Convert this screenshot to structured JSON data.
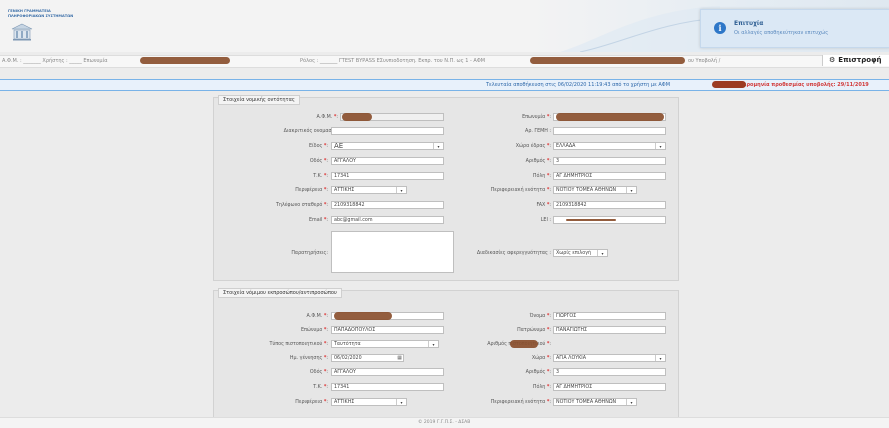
{
  "header": {
    "logo_line1": "ΓΕΝΙΚΗ ΓΡΑΜΜΑΤΕΙΑ",
    "logo_line2": "ΠΛΗΡΟΦΟΡΙΑΚΩΝ ΣΥΣΤΗΜΑΤΩΝ"
  },
  "notification": {
    "title": "Επιτυχία",
    "message": "Οι αλλαγές αποθηκεύτηκαν επιτυχώς"
  },
  "infobar": {
    "afm": "Α.Φ.Μ. : _______ Χρήστης : _____ Επωνυμία",
    "user": "",
    "role": "Ρόλος : _______  ΓΤΕST ΒΥΡΑSS ΕΣυνπιοδοτηση. Εκπρ. του Ν.Π. ως 1 - ΑΦΜ",
    "profile": "ου Υποβολή /",
    "back_label": "Επιστροφή"
  },
  "savebar": {
    "saved_text": "Τελευταία αποθήκευση στις 06/02/2020 11:19:43 από το χρήστη με ΑΦΜ",
    "deadline_text": "μερομηνία προθεσμίας υποβολής: 29/11/2019"
  },
  "section1": {
    "legend": "Στοιχεία νομικής οντότητας",
    "afm_label": "Α.Φ.Μ.",
    "company_name_label": "Επωνυμία",
    "distinctive_title_label": "Διακριτικός ονομασία:",
    "gemi_label": "Αρ. ΓΕΜΗ :",
    "type_label": "Είδος",
    "type_value": "ΑΕ",
    "country_label": "Χώρα έδρας",
    "country_value": "ΕΛΛΑΔΑ",
    "street_label": "Οδός",
    "street_value": "ΑΓΓΑΛΟΥ",
    "number_label": "Αριθμός",
    "number_value": "3",
    "zip_label": "Τ.Κ.",
    "zip_value": "17341",
    "city_label": "Πόλη",
    "city_value": "ΑΓ ΔΗΜΗΤΡΙΟΣ",
    "region_label": "Περιφέρεια",
    "region_value": "ΑΤΤΙΚΗΣ",
    "regional_unit_label": "Περιφερειακή ενότητα",
    "regional_unit_value": "ΝΟΤΙΟΥ ΤΟΜΕΑ ΑΘΗΝΩΝ",
    "phone_label": "Τηλέφωνο σταθερό",
    "phone_value": "2109318842",
    "fax_label": "FAX",
    "fax_value": "2109318842",
    "email_label": "Email",
    "email_value": "abc@gmail.com",
    "lei_label": "LEI :",
    "notes_label": "Παρατηρήσεις:",
    "auth_label": "Διαδικασίες αφερεγγυότητας :",
    "auth_value": "Χωρίς επιλογή"
  },
  "section2": {
    "legend": "Στοιχεία νόμιμου εκπροσώπου/αντιπροσώπου",
    "afm_label": "Α.Φ.Μ.",
    "first_name_label": "Όνομα",
    "first_name_value": "ΓΙΩΡΓΟΣ",
    "surname_label": "Επώνυμο",
    "surname_value": "ΠΑΠΑΔΟΠΟΥΛΟΣ",
    "father_label": "Πατρώνυμο",
    "father_value": "ΠΑΝΑΓΙΩΤΗΣ",
    "id_type_label": "Τύπος πιστοποιητικού",
    "id_type_value": "Ταυτότητα",
    "id_number_label": "Αριθμός πιστοποιητικού",
    "dob_label": "Ημ. γέννησης",
    "dob_value": "06/02/2020",
    "country_label": "Χώρα",
    "country_value": "ΑΓΙΑ ΛΟΥΚΙΑ",
    "street_label": "Οδός",
    "street_value": "ΑΓΓΑΛΟΥ",
    "number_label": "Αριθμός",
    "number_value": "3",
    "zip_label": "Τ.Κ.",
    "zip_value": "17341",
    "city_label": "Πόλη",
    "city_value": "ΑΓ ΔΗΜΗΤΡΙΟΣ",
    "region_label": "Περιφέρεια",
    "region_value": "ΑΤΤΙΚΗΣ",
    "regional_unit_label": "Περιφερειακή ενότητα",
    "regional_unit_value": "ΝΟΤΙΟΥ ΤΟΜΕΑ ΑΘΗΝΩΝ"
  },
  "footer": {
    "text": "© 2019 Γ.Γ.Π.Σ. - ΔΣΑΒ"
  },
  "colors": {
    "accent": "#2e77c8",
    "deadline": "#d13a3a",
    "redaction": "#8a4f2e"
  },
  "icons": [
    "info-icon",
    "gear-icon",
    "building-icon",
    "calendar-icon",
    "chevron-down-icon"
  ]
}
